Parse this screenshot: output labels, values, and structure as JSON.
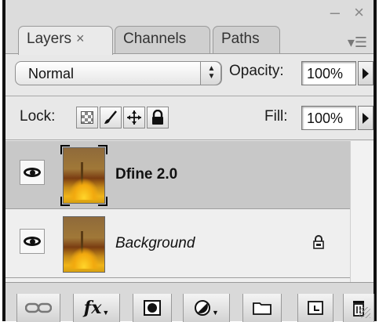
{
  "window": {
    "minimize_glyph": "–",
    "close_glyph": "×",
    "panel_menu_glyph": "▾☰"
  },
  "tabs": [
    {
      "label": "Layers",
      "close": "×",
      "active": true
    },
    {
      "label": "Channels",
      "active": false
    },
    {
      "label": "Paths",
      "active": false
    }
  ],
  "blend_mode": {
    "value": "Normal",
    "stepper": "▲▼"
  },
  "opacity": {
    "label": "Opacity:",
    "value": "100%"
  },
  "lock": {
    "label": "Lock:",
    "icons": [
      "lock-transparent-pixels-icon",
      "lock-image-pixels-icon",
      "lock-position-icon",
      "lock-all-icon"
    ]
  },
  "fill": {
    "label": "Fill:",
    "value": "100%"
  },
  "layers": [
    {
      "name": "Dfine 2.0",
      "visible": true,
      "selected": true,
      "style": "bold",
      "locked": false
    },
    {
      "name": "Background",
      "visible": true,
      "selected": false,
      "style": "italic",
      "locked": true
    }
  ],
  "bottom_toolbar": {
    "buttons": [
      "link-layers-icon",
      "fx-icon",
      "layer-mask-icon",
      "adjustment-layer-icon",
      "new-group-icon",
      "new-layer-icon",
      "trash-icon"
    ],
    "fx_label": "fx"
  },
  "colors": {
    "panel_bg": "#e8e8e8",
    "selected_row": "#c8c8c8",
    "frame": "#111111"
  }
}
